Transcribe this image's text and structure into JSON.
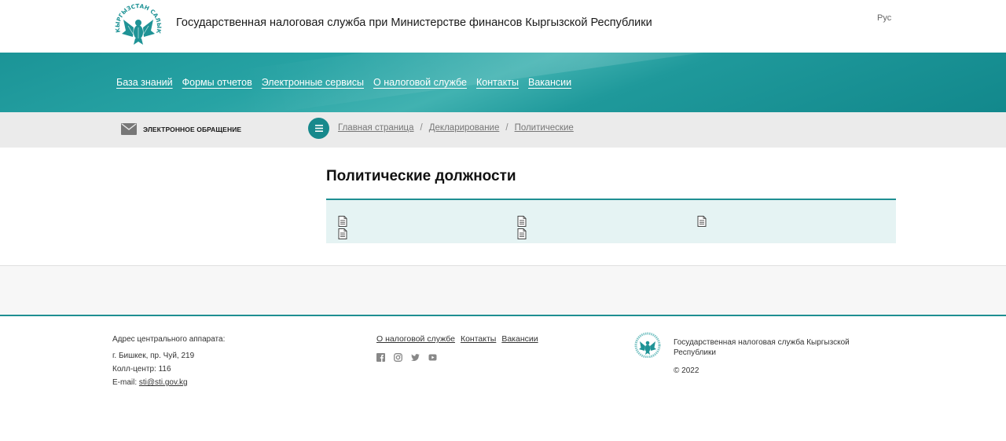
{
  "header": {
    "logo_text": "КЫРГЫЗСТАН САЛЫК КЫЗМАТЫ",
    "site_title": "Государственная налоговая служба при Министерстве финансов Кыргызской Республики",
    "language": "Рус"
  },
  "nav": {
    "items": [
      {
        "label": "База знаний"
      },
      {
        "label": "Формы отчетов"
      },
      {
        "label": "Электронные сервисы"
      },
      {
        "label": "О налоговой службе"
      },
      {
        "label": "Контакты"
      },
      {
        "label": "Вакансии"
      }
    ]
  },
  "subbar": {
    "e_appeal_label": "ЭЛЕКТРОННОЕ ОБРАЩЕНИЕ",
    "breadcrumb": [
      "Главная страница",
      "Декларирование",
      "Политические"
    ],
    "separator": "/"
  },
  "main": {
    "title": "Политические должности",
    "documents": [
      {
        "icon": "document-icon",
        "label": ""
      },
      {
        "icon": "document-icon",
        "label": ""
      },
      {
        "icon": "document-icon",
        "label": ""
      },
      {
        "icon": "document-icon",
        "label": ""
      },
      {
        "icon": "document-icon",
        "label": ""
      }
    ]
  },
  "footer": {
    "address_title": "Адрес центрального аппарата:",
    "address": "г. Бишкек, пр. Чуй, 219",
    "call_center": "Колл-центр: 116",
    "email_label": "E-mail: ",
    "email": "sti@sti.gov.kg",
    "links": [
      "О налоговой службе",
      "Контакты",
      "Вакансии"
    ],
    "socials": [
      "facebook-icon",
      "instagram-icon",
      "twitter-icon",
      "youtube-icon"
    ],
    "org_name": "Государственная налоговая служба Кыргызской Республики",
    "copyright": "© 2022"
  },
  "colors": {
    "accent": "#1e8f92",
    "nav_band": "#1b9497",
    "subbar": "#ebebeb",
    "panel": "#e5f3f3"
  }
}
